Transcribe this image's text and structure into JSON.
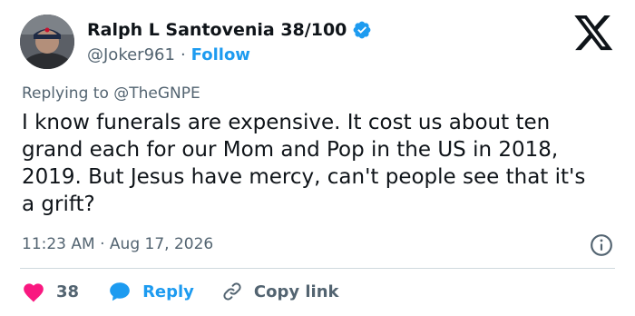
{
  "author": {
    "name": "Ralph L Santovenia 38/100",
    "handle": "@Joker961",
    "separator": "·",
    "follow_label": "Follow"
  },
  "reply_context": {
    "prefix": "Replying to",
    "mention": "@TheGNPE"
  },
  "tweet": {
    "text": "I know funerals are expensive. It cost us about ten grand each for our Mom and Pop in the US in 2018, 2019. But Jesus have mercy, can't people see that it's a grift?",
    "time": "11:23 AM",
    "separator": "·",
    "date": "Aug 17, 2026"
  },
  "actions": {
    "like_count": "38",
    "reply_label": "Reply",
    "copy_label": "Copy link"
  },
  "icons": {
    "verified": "verified-badge-icon",
    "x_logo": "x-logo-icon",
    "info": "info-icon",
    "like": "heart-icon",
    "reply": "reply-bubble-icon",
    "copy": "link-icon"
  },
  "colors": {
    "accent": "#1d9bf0",
    "like": "#f91880",
    "text": "#0f1419",
    "muted": "#536471",
    "divider": "#cfd9de"
  }
}
